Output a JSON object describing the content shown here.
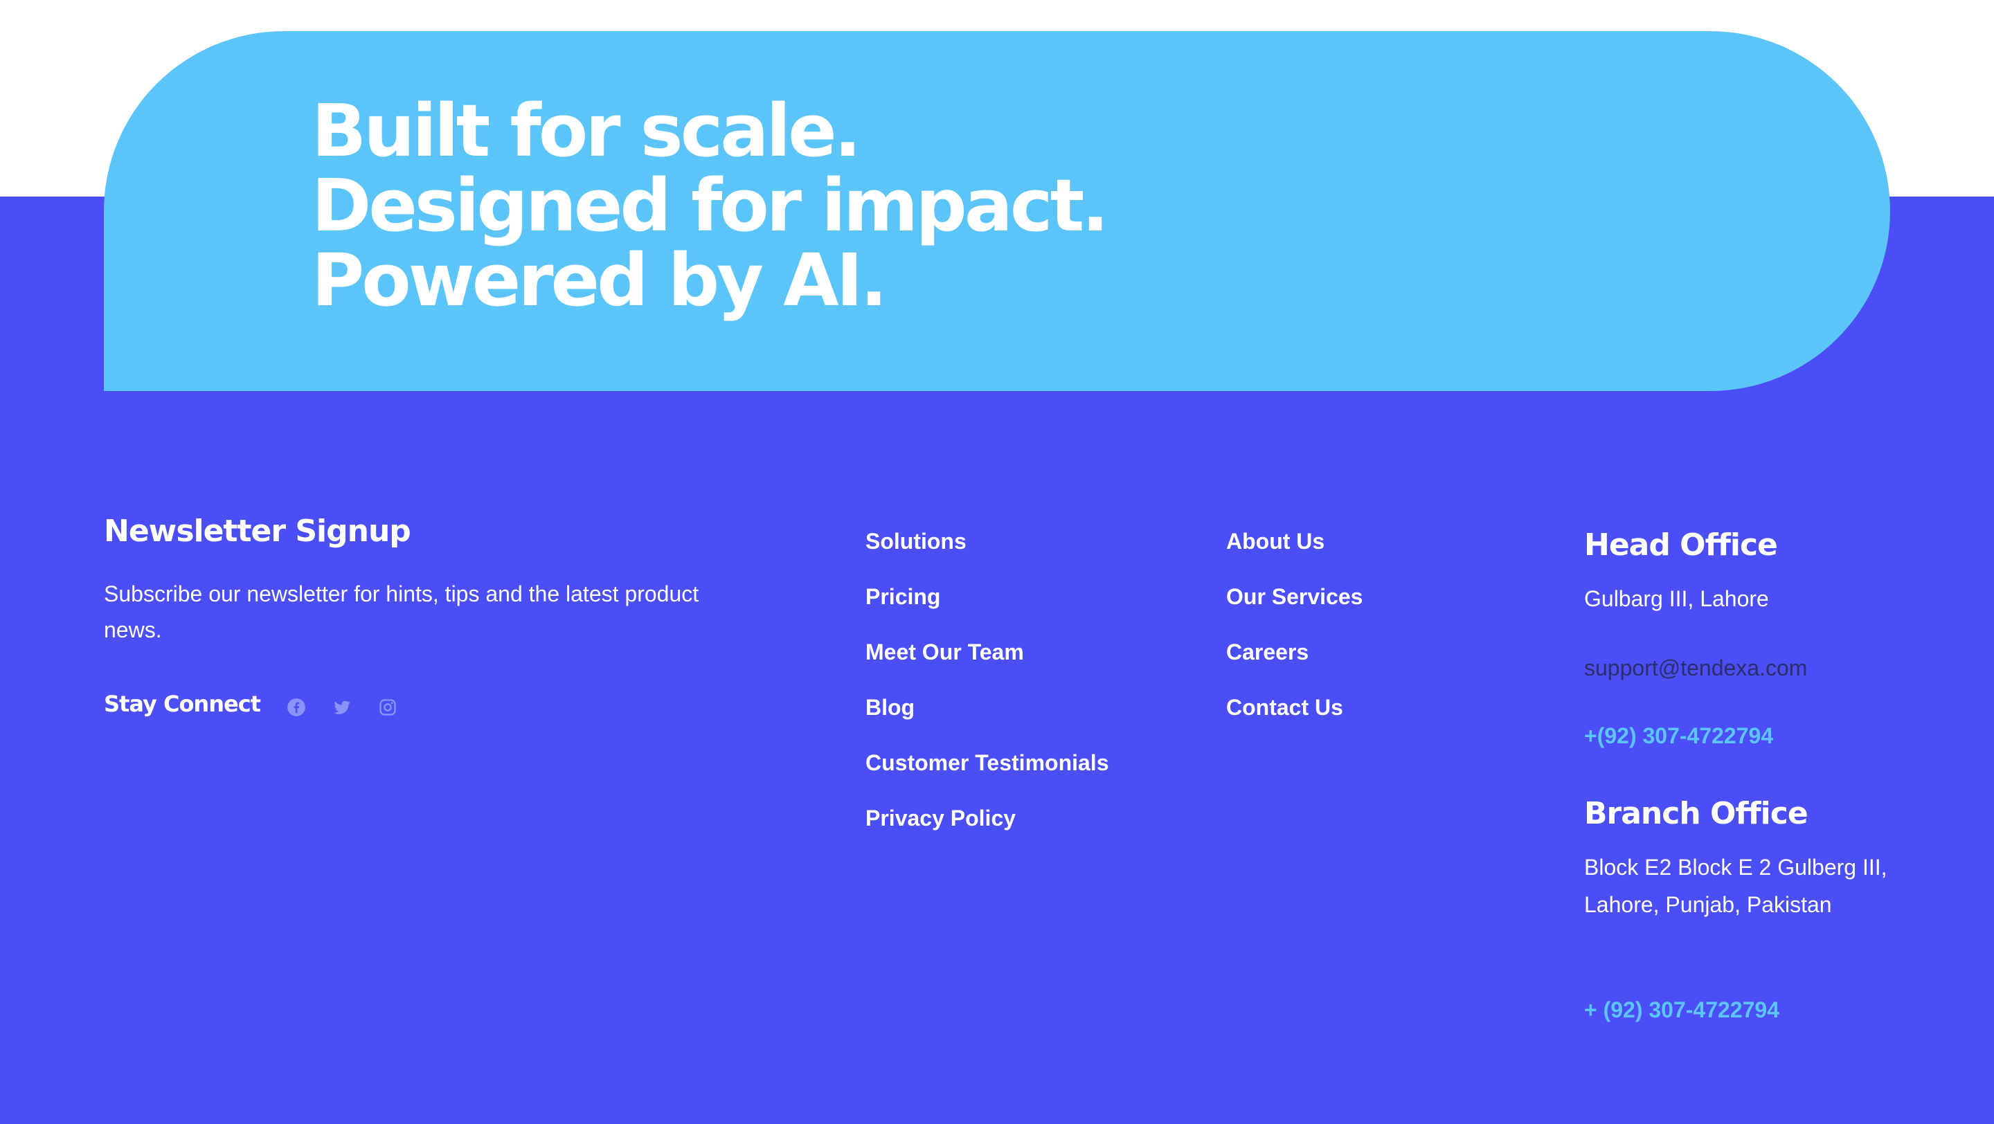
{
  "hero": {
    "line1": "Built for scale.",
    "line2": "Designed for impact.",
    "line3": "Powered by AI."
  },
  "newsletter": {
    "title": "Newsletter Signup",
    "description": "Subscribe our newsletter for hints, tips and the latest product news.",
    "stay_connect": "Stay Connect",
    "social_icons": [
      "facebook-icon",
      "twitter-icon",
      "instagram-icon"
    ]
  },
  "links_col1": [
    "Solutions",
    "Pricing",
    "Meet Our Team",
    "Blog",
    "Customer Testimonials",
    "Privacy Policy"
  ],
  "links_col2": [
    "About Us",
    "Our Services",
    "Careers",
    "Contact Us"
  ],
  "head_office": {
    "title": "Head Office",
    "address": "Gulbarg III, Lahore",
    "email": "support@tendexa.com",
    "phone": "+(92) 307-4722794"
  },
  "branch_office": {
    "title": "Branch Office",
    "address": "Block E2 Block E 2 Gulberg III, Lahore, Punjab, Pakistan",
    "phone": "+ (92) 307-4722794"
  },
  "colors": {
    "footer_bg": "#4B4EF5",
    "hero_bg": "#5BC5FA",
    "phone_accent": "#5BC5FA",
    "email_text": "#2B2E6B",
    "social_icon": "#8C93F8"
  }
}
